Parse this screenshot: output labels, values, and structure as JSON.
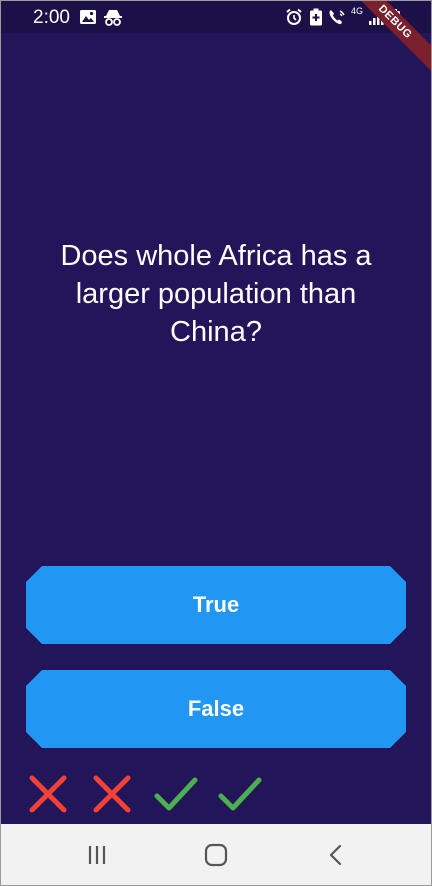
{
  "status_bar": {
    "time": "2:00",
    "network": "4G",
    "left_icons": [
      "image-icon",
      "incognito-icon"
    ],
    "right_icons": [
      "alarm-icon",
      "battery-saver-icon",
      "wifi-calling-icon",
      "signal-icon",
      "battery-icon"
    ]
  },
  "debug_banner": {
    "label": "DEBUG"
  },
  "quiz": {
    "question": "Does whole Africa has a larger population than China?",
    "true_label": "True",
    "false_label": "False",
    "colors": {
      "background": "#23155a",
      "button": "#2196f3",
      "wrong": "#f44336",
      "correct": "#4caf50"
    }
  },
  "score_keeper": [
    "wrong",
    "wrong",
    "correct",
    "correct"
  ],
  "nav_bar": {
    "buttons": [
      "recents-icon",
      "home-icon",
      "back-icon"
    ]
  }
}
